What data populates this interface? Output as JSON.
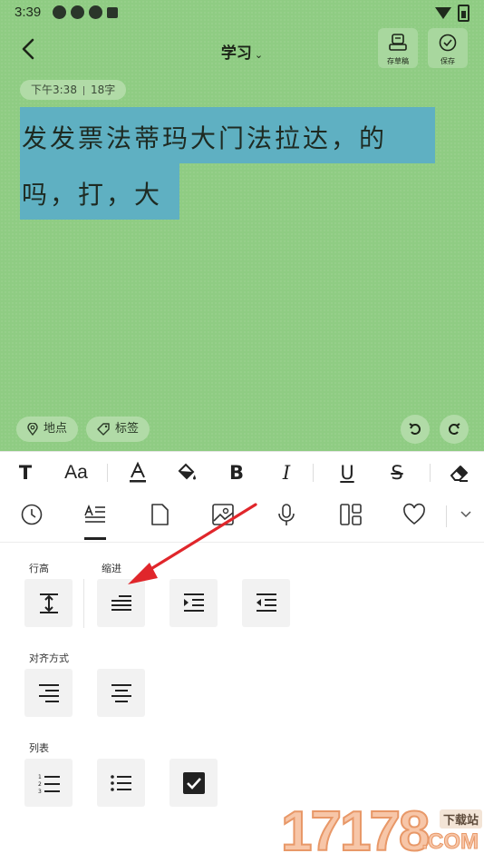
{
  "status": {
    "time": "3:39"
  },
  "header": {
    "title": "学习",
    "draft_label": "存草稿",
    "save_label": "保存"
  },
  "note": {
    "time": "下午3:38",
    "count": "18字",
    "lines": [
      "发发票法蒂玛大门法拉达，的",
      "吗，打，大"
    ]
  },
  "chips": {
    "location": "地点",
    "tag": "标签"
  },
  "panel": {
    "line_height_label": "行高",
    "indent_label": "缩进",
    "align_label": "对齐方式",
    "list_label": "列表"
  },
  "watermark": {
    "number": "17178",
    "site": "下载站",
    "domain": ".COM"
  },
  "colors": {
    "note_bg": "#8fcc83",
    "highlight": "#5fb0c2",
    "arrow": "#e0262b"
  }
}
